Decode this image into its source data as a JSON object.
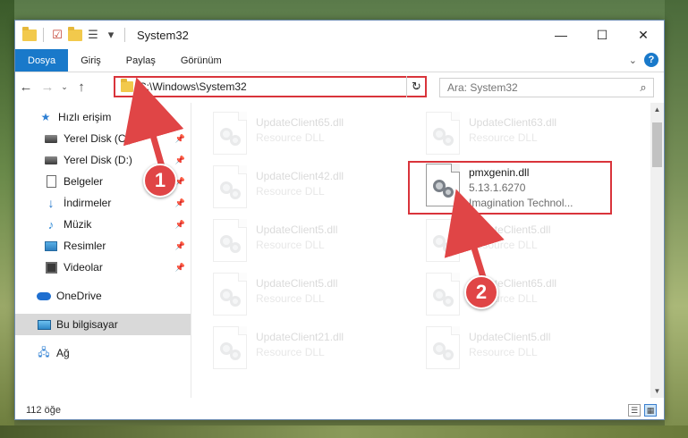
{
  "window": {
    "title": "System32"
  },
  "win_controls": {
    "minimize": "—",
    "maximize": "☐",
    "close": "✕"
  },
  "ribbon": {
    "tabs": [
      "Dosya",
      "Giriş",
      "Paylaş",
      "Görünüm"
    ],
    "collapse": "⌄",
    "help": "?"
  },
  "address": {
    "path": "C:\\Windows\\System32",
    "dropdown": "⌄",
    "refresh": "↻"
  },
  "nav": {
    "back": "←",
    "forward": "→",
    "recent": "⌄",
    "up": "↑"
  },
  "search": {
    "placeholder": "Ara: System32",
    "icon": "⌕"
  },
  "sidebar": {
    "items": [
      {
        "label": "Hızlı erişim",
        "icon": "star-icon",
        "pinned": false
      },
      {
        "label": "Yerel Disk (C:)",
        "icon": "disk-icon",
        "pinned": true
      },
      {
        "label": "Yerel Disk (D:)",
        "icon": "disk-icon",
        "pinned": true
      },
      {
        "label": "Belgeler",
        "icon": "document-icon",
        "pinned": true
      },
      {
        "label": "İndirmeler",
        "icon": "download-icon",
        "pinned": true
      },
      {
        "label": "Müzik",
        "icon": "music-icon",
        "pinned": true
      },
      {
        "label": "Resimler",
        "icon": "pictures-icon",
        "pinned": true
      },
      {
        "label": "Videolar",
        "icon": "videos-icon",
        "pinned": true
      },
      {
        "label": "OneDrive",
        "icon": "cloud-icon",
        "pinned": false
      },
      {
        "label": "Bu bilgisayar",
        "icon": "computer-icon",
        "pinned": false,
        "selected": true
      },
      {
        "label": "Ağ",
        "icon": "network-icon",
        "pinned": false
      }
    ],
    "pin_glyph": "📌"
  },
  "files": [
    {
      "name": "UpdateClient65.dll",
      "type": "Resource DLL",
      "faded": true
    },
    {
      "name": "UpdateClient63.dll",
      "type": "Resource DLL",
      "faded": true
    },
    {
      "name": "UpdateClient42.dll",
      "type": "Resource DLL",
      "faded": true
    },
    {
      "name": "pmxgenin.dll",
      "version": "5.13.1.6270",
      "type": "Imagination Technol...",
      "faded": false,
      "highlighted": true
    },
    {
      "name": "UpdateClient5.dll",
      "type": "Resource DLL",
      "faded": true
    },
    {
      "name": "UpdateClient5.dll",
      "type": "Resource DLL",
      "faded": true
    },
    {
      "name": "UpdateClient5.dll",
      "type": "Resource DLL",
      "faded": true
    },
    {
      "name": "UpdateClient65.dll",
      "type": "Resource DLL",
      "faded": true
    },
    {
      "name": "UpdateClient21.dll",
      "type": "Resource DLL",
      "faded": true
    },
    {
      "name": "UpdateClient5.dll",
      "type": "Resource DLL",
      "faded": true
    }
  ],
  "status": {
    "item_count": "112 öğe"
  },
  "annotations": {
    "step1": "1",
    "step2": "2",
    "accent": "#d9343b"
  },
  "colors": {
    "file_tab": "#1979ca",
    "selected": "#d9d9d9"
  }
}
